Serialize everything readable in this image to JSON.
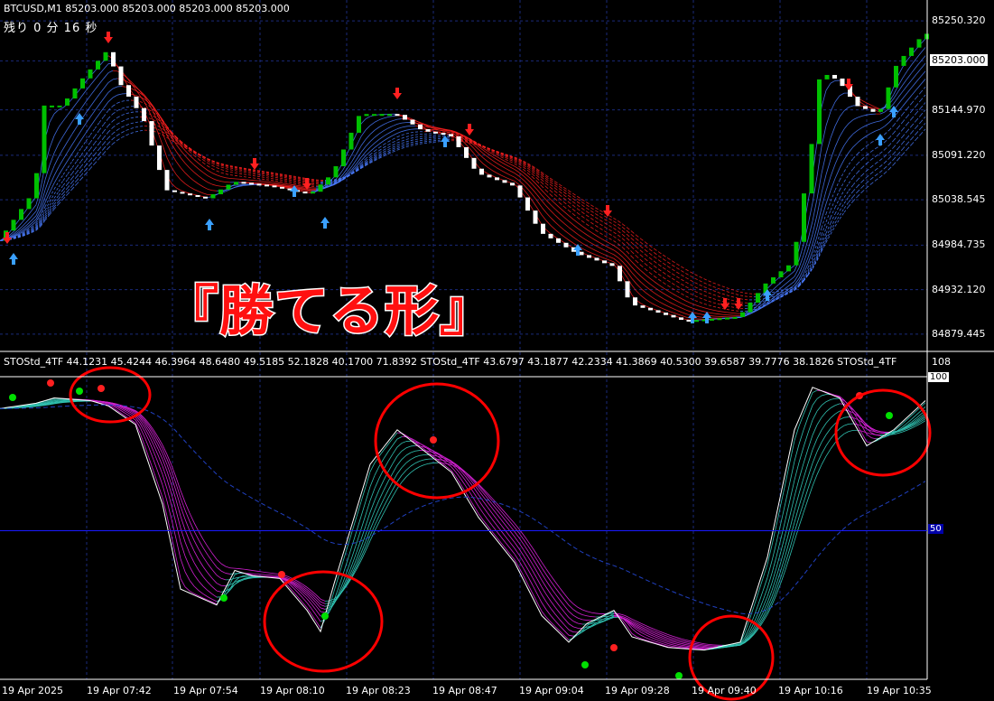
{
  "main": {
    "header": "BTCUSD,M1  85203.000 85203.000 85203.000 85203.000",
    "timer": "残り 0 分 16 秒",
    "caption": "『勝てる形』",
    "price_levels": [
      {
        "label": "85250.320",
        "price": 85250.32
      },
      {
        "label": "85203.000",
        "price": 85203.0,
        "current": true
      },
      {
        "label": "85144.970",
        "price": 85144.97
      },
      {
        "label": "85091.220",
        "price": 85091.22
      },
      {
        "label": "85038.545",
        "price": 85038.545
      },
      {
        "label": "84984.735",
        "price": 84984.735
      },
      {
        "label": "84932.120",
        "price": 84932.12
      },
      {
        "label": "84879.445",
        "price": 84879.445
      }
    ],
    "price_range": [
      84860,
      85275
    ]
  },
  "indicator": {
    "header": "STOStd_4TF 44.1231 45.4244 46.3964 48.6480 49.5185 52.1828 40.1700 71.8392  STOStd_4TF 43.6797 43.1877 42.2334 41.3869 40.5300 39.6587 39.7776 38.1826  STOStd_4TF",
    "max_label": "108",
    "level_100": "100",
    "level_50": "50",
    "range": [
      -6,
      108
    ]
  },
  "time_labels": [
    "19 Apr 2025",
    "19 Apr 07:42",
    "19 Apr 07:54",
    "19 Apr 08:10",
    "19 Apr 08:23",
    "19 Apr 08:47",
    "19 Apr 09:04",
    "19 Apr 09:28",
    "19 Apr 09:40",
    "19 Apr 10:16",
    "19 Apr 10:35"
  ],
  "colors": {
    "bull": "#00c000",
    "bear": "#ffffff",
    "up_ribbon": "#4a7cff",
    "down_ribbon": "#ff2020",
    "grid": "#1a2a7a",
    "stoch_up": "#30c0b0",
    "stoch_down": "#d020d0",
    "circle": "#ff0000"
  },
  "chart_data": [
    {
      "type": "line",
      "title": "BTCUSD,M1",
      "x": [
        "19 Apr 2025",
        "19 Apr 07:42",
        "19 Apr 07:54",
        "19 Apr 08:10",
        "19 Apr 08:23",
        "19 Apr 08:47",
        "19 Apr 09:04",
        "19 Apr 09:28",
        "19 Apr 09:40",
        "19 Apr 10:16",
        "19 Apr 10:35"
      ],
      "series": [
        {
          "values": [
            84990,
            85150,
            85045,
            85050,
            85135,
            85100,
            85010,
            84905,
            84935,
            85190,
            85240
          ]
        }
      ],
      "ylim": [
        84860,
        85275
      ]
    },
    {
      "type": "line",
      "title": "STOStd_4TF",
      "x": [
        "19 Apr 2025",
        "19 Apr 07:42",
        "19 Apr 07:54",
        "19 Apr 08:10",
        "19 Apr 08:23",
        "19 Apr 08:47",
        "19 Apr 09:04",
        "19 Apr 09:28",
        "19 Apr 09:40",
        "19 Apr 10:16",
        "19 Apr 10:35"
      ],
      "series": [
        {
          "values": [
            96,
            98,
            25,
            32,
            88,
            75,
            30,
            12,
            6,
            88,
            99
          ]
        }
      ],
      "ylim": [
        -6,
        108
      ]
    }
  ]
}
